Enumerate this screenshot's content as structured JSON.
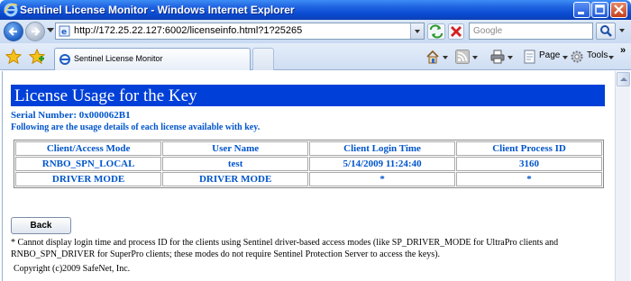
{
  "window": {
    "title": "Sentinel License Monitor - Windows Internet Explorer"
  },
  "address_bar": {
    "url": "http://172.25.22.127:6002/licenseinfo.html?1?25265",
    "search_placeholder": "Google"
  },
  "tabs": [
    {
      "label": "Sentinel License Monitor"
    }
  ],
  "command_bar": {
    "page_label": "Page",
    "tools_label": "Tools"
  },
  "page": {
    "heading": "License Usage for the Key",
    "serial_number": "Serial Number: 0x000062B1",
    "subtitle": "Following are the usage details of each license available with key.",
    "table": {
      "headers": [
        "Client/Access Mode",
        "User Name",
        "Client Login Time",
        "Client Process ID"
      ],
      "rows": [
        [
          "RNBO_SPN_LOCAL",
          "test",
          "5/14/2009 11:24:40",
          "3160"
        ],
        [
          "DRIVER MODE",
          "DRIVER MODE",
          "*",
          "*"
        ]
      ]
    },
    "back_button": "Back",
    "note": "* Cannot display login time and process ID for the clients using Sentinel driver-based access modes (like SP_DRIVER_MODE for UltraPro clients and RNBO_SPN_DRIVER for SuperPro clients; these modes do not require Sentinel Protection Server to access the keys).",
    "copyright": "Copyright (c)2009 SafeNet, Inc."
  },
  "colors": {
    "heading_background": "#0040d8",
    "text_blue": "#0055cc",
    "titlebar_blue": "#0a4bd3"
  }
}
